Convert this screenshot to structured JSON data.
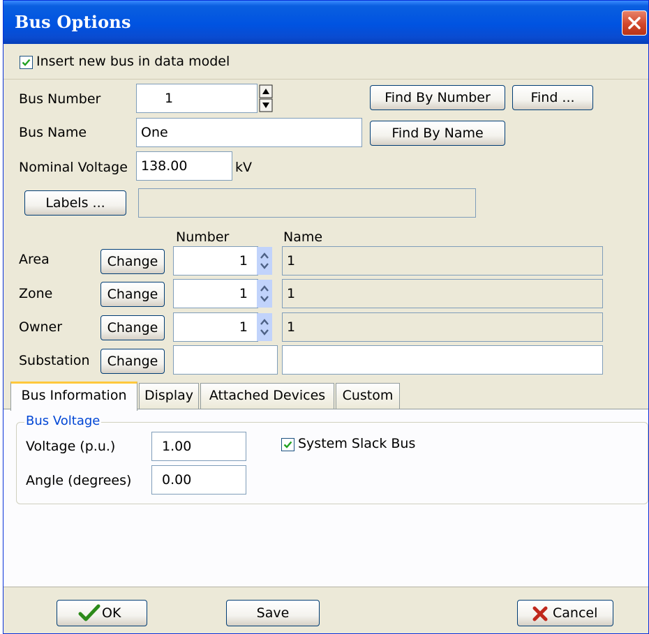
{
  "window": {
    "title": "Bus Options"
  },
  "insert_new_bus": {
    "checked": true,
    "label": "Insert new bus in data model"
  },
  "bus_number": {
    "label": "Bus Number",
    "value": "1"
  },
  "bus_name": {
    "label": "Bus Name",
    "value": "One"
  },
  "nominal_voltage": {
    "label": "Nominal Voltage",
    "value": "138.00",
    "unit": "kV"
  },
  "buttons": {
    "find_by_number": "Find By Number",
    "find": "Find ...",
    "find_by_name": "Find By Name",
    "labels": "Labels ...",
    "ok": "OK",
    "save": "Save",
    "cancel": "Cancel"
  },
  "labels_value": "",
  "grid": {
    "col_number": "Number",
    "col_name": "Name",
    "change_label": "Change",
    "rows": [
      {
        "label": "Area",
        "number": "1",
        "name": "1"
      },
      {
        "label": "Zone",
        "number": "1",
        "name": "1"
      },
      {
        "label": "Owner",
        "number": "1",
        "name": "1"
      },
      {
        "label": "Substation",
        "number": "",
        "name": ""
      }
    ]
  },
  "tabs": [
    "Bus Information",
    "Display",
    "Attached Devices",
    "Custom"
  ],
  "active_tab": "Bus Information",
  "bus_voltage": {
    "group_title": "Bus Voltage",
    "voltage_label": "Voltage (p.u.)",
    "voltage_value": "1.00",
    "angle_label": "Angle (degrees)",
    "angle_value": "0.00",
    "slack_label": "System Slack Bus",
    "slack_checked": true
  },
  "colors": {
    "titlebar": "#0053e1",
    "dialog_bg": "#ece9d8",
    "accent_tab": "#ffc83c",
    "group_title": "#0046d5",
    "ok_check": "#2c8a1a",
    "cancel_x": "#c0281c"
  }
}
